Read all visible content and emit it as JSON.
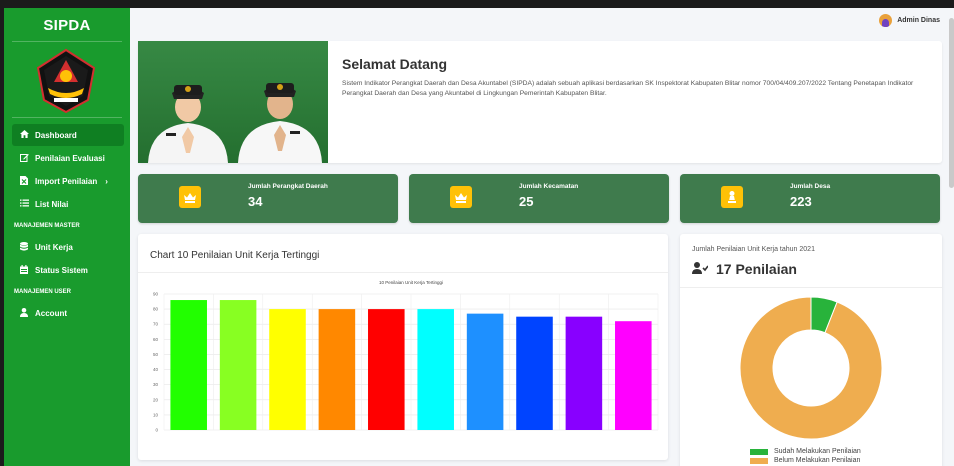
{
  "sidebar": {
    "brand": "SIPDA",
    "items": [
      {
        "label": "Dashboard",
        "icon": "home-icon"
      },
      {
        "label": "Penilaian Evaluasi",
        "icon": "edit-icon"
      },
      {
        "label": "Import Penilaian",
        "icon": "file-excel-icon"
      },
      {
        "label": "List Nilai",
        "icon": "list-icon"
      }
    ],
    "section_master": "MANAJEMEN MASTER",
    "master_items": [
      {
        "label": "Unit Kerja",
        "icon": "database-icon"
      },
      {
        "label": "Status Sistem",
        "icon": "calendar-icon"
      }
    ],
    "section_user": "MANAJEMEN USER",
    "user_items": [
      {
        "label": "Account",
        "icon": "user-icon"
      }
    ]
  },
  "topbar": {
    "user_name": "Admin Dinas"
  },
  "welcome": {
    "title": "Selamat Datang",
    "text": "Sistem Indikator Perangkat Daerah dan Desa Akuntabel (SIPDA) adalah sebuah aplikasi berdasarkan SK Inspektorat Kabupaten Blitar nomor 700/04/409.207/2022 Tentang Penetapan Indikator Perangkat Daerah dan Desa yang Akuntabel di Lingkungan Pemerintah Kabupaten Blitar."
  },
  "stats": [
    {
      "label": "Jumlah Perangkat Daerah",
      "value": "34",
      "icon": "crown-icon"
    },
    {
      "label": "Jumlah Kecamatan",
      "value": "25",
      "icon": "crown-icon"
    },
    {
      "label": "Jumlah Desa",
      "value": "223",
      "icon": "chess-icon"
    }
  ],
  "bar_card": {
    "title": "Chart 10 Penilaian Unit Kerja Tertinggi"
  },
  "pie_card": {
    "subtitle": "Jumlah Penilaian Unit Kerja tahun 2021",
    "count": "17 Penilaian"
  },
  "colors": {
    "sidebar": "#199b2d",
    "stat_bg": "#3f7b4d",
    "stat_icon": "#ffc107"
  },
  "chart_data": [
    {
      "type": "bar",
      "title": "10 Penilaian Unit Kerja Tertinggi",
      "categories": [
        "",
        "",
        "",
        "",
        "",
        "",
        "",
        "",
        "",
        ""
      ],
      "values": [
        86,
        86,
        80,
        80,
        80,
        80,
        77,
        75,
        75,
        72
      ],
      "colors": [
        "#22ff00",
        "#88ff22",
        "#ffff00",
        "#ff8800",
        "#ff0000",
        "#00ffff",
        "#1e90ff",
        "#0044ff",
        "#8800ff",
        "#ff00ff"
      ],
      "ylim": [
        0,
        90
      ],
      "yticks": [
        "0",
        "10",
        "20",
        "30",
        "40",
        "50",
        "60",
        "70",
        "80",
        "90"
      ],
      "grid": true
    },
    {
      "type": "pie",
      "labels": [
        "Sudah Melakukan Penilaian",
        "Belum Melakukan Penilaian"
      ],
      "values": [
        6,
        94
      ],
      "colors": [
        "#28b33b",
        "#efad4f"
      ],
      "legend": "bottom"
    }
  ]
}
